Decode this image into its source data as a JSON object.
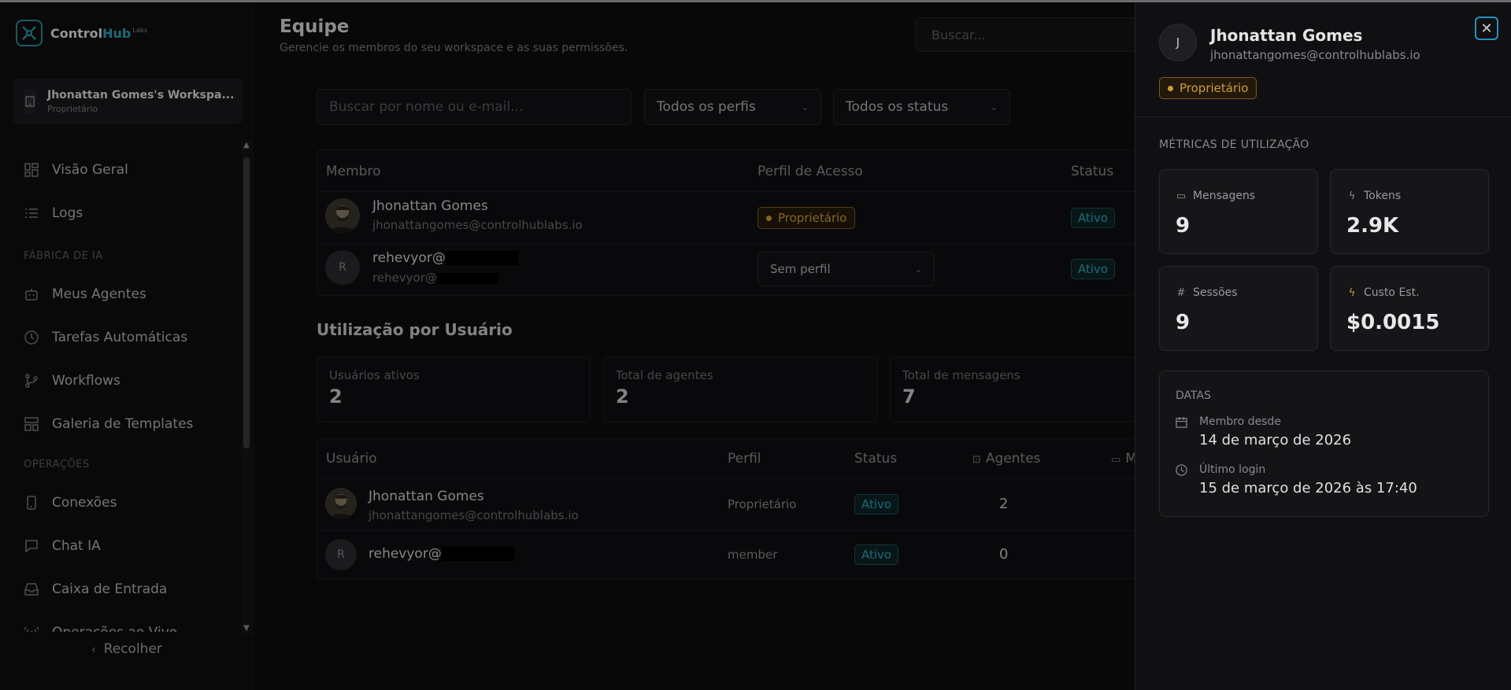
{
  "app": {
    "logo_prefix": "Control",
    "logo_hub": "Hub",
    "logo_suffix": "Labs"
  },
  "workspace": {
    "name": "Jhonattan Gomes's Workspa...",
    "role": "Proprietário"
  },
  "sidebar": {
    "items": [
      {
        "label": "Visão Geral",
        "icon": "dashboard-grid-icon"
      },
      {
        "label": "Logs",
        "icon": "list-icon"
      },
      {
        "label": "Meus Agentes",
        "icon": "robot-icon"
      },
      {
        "label": "Tarefas Automáticas",
        "icon": "clock-icon"
      },
      {
        "label": "Workflows",
        "icon": "git-branch-icon"
      },
      {
        "label": "Galeria de Templates",
        "icon": "template-icon"
      },
      {
        "label": "Conexões",
        "icon": "smartphone-icon"
      },
      {
        "label": "Chat IA",
        "icon": "chat-icon"
      },
      {
        "label": "Caixa de Entrada",
        "icon": "inbox-icon"
      },
      {
        "label": "Operações ao Vivo",
        "icon": "broadcast-icon"
      }
    ],
    "sections": {
      "ai_factory": "FÁBRICA DE IA",
      "operations": "OPERAÇÕES"
    },
    "collapse_label": "Recolher"
  },
  "header": {
    "title": "Equipe",
    "subtitle": "Gerencie os membros do seu workspace e as suas permissões.",
    "search_placeholder": "Buscar..."
  },
  "filters": {
    "search_placeholder": "Buscar por nome ou e-mail...",
    "profile_select": "Todos os perfis",
    "status_select": "Todos os status"
  },
  "members_table": {
    "headers": {
      "member": "Membro",
      "access_profile": "Perfil de Acesso",
      "status": "Status"
    },
    "rows": [
      {
        "name": "Jhonattan Gomes",
        "email": "jhonattangomes@controlhublabs.io",
        "role_badge": "Proprietário",
        "status": "Ativo"
      },
      {
        "avatar_initial": "R",
        "name": "rehevyor@",
        "email": "rehevyor@",
        "role_select": "Sem perfil",
        "status": "Ativo"
      }
    ]
  },
  "usage": {
    "title": "Utilização por Usuário",
    "stats": [
      {
        "label": "Usuários ativos",
        "value": "2"
      },
      {
        "label": "Total de agentes",
        "value": "2"
      },
      {
        "label": "Total de mensagens",
        "value": "7"
      }
    ],
    "table": {
      "headers": {
        "user": "Usuário",
        "profile": "Perfil",
        "status": "Status",
        "agents": "Agentes",
        "messages": "M"
      },
      "rows": [
        {
          "name": "Jhonattan Gomes",
          "email": "jhonattangomes@controlhublabs.io",
          "profile": "Proprietário",
          "status": "Ativo",
          "agents": "2"
        },
        {
          "avatar_initial": "R",
          "name": "rehevyor@",
          "profile": "member",
          "status": "Ativo",
          "agents": "0"
        }
      ]
    }
  },
  "drawer": {
    "avatar_initial": "J",
    "name": "Jhonattan Gomes",
    "email": "jhonattangomes@controlhublabs.io",
    "role_badge": "Proprietário",
    "metrics_title": "MÉTRICAS DE UTILIZAÇÃO",
    "metrics": [
      {
        "label": "Mensagens",
        "value": "9",
        "icon": "message-icon"
      },
      {
        "label": "Tokens",
        "value": "2.9K",
        "icon": "lightning-icon"
      },
      {
        "label": "Sessões",
        "value": "9",
        "icon": "hash-icon"
      },
      {
        "label": "Custo Est.",
        "value": "$0.0015",
        "icon": "cost-lightning-icon"
      }
    ],
    "dates_title": "DATAS",
    "dates": [
      {
        "label": "Membro desde",
        "value": "14 de março de 2026",
        "icon": "calendar-icon"
      },
      {
        "label": "Último login",
        "value": "15 de março de 2026 às 17:40",
        "icon": "clock-icon"
      }
    ]
  },
  "colors": {
    "accent": "#2aa6b8",
    "owner_badge": "#d09a3a",
    "background": "#0d0d0e"
  }
}
